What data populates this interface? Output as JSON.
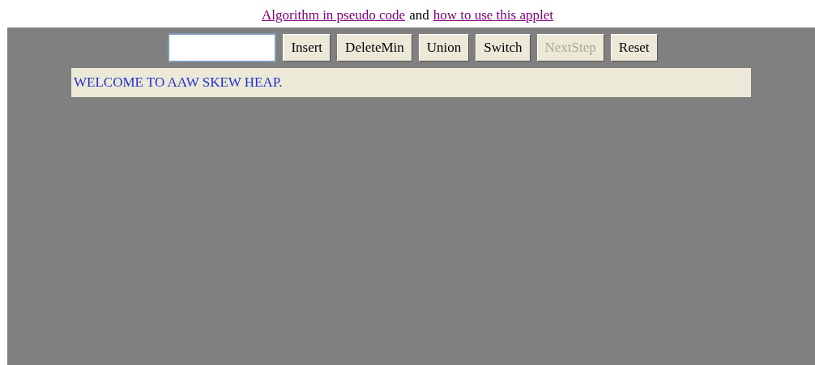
{
  "header": {
    "parts": [
      {
        "kind": "link",
        "text": "Algorithm in pseudo code"
      },
      {
        "kind": "plain",
        "text": "and"
      },
      {
        "kind": "link",
        "text": "how to use this applet"
      }
    ]
  },
  "toolbar": {
    "buttons": [
      {
        "label": "Insert",
        "disabled": false
      },
      {
        "label": "DeleteMin",
        "disabled": false
      },
      {
        "label": "Union",
        "disabled": false
      },
      {
        "label": "Switch",
        "disabled": false
      },
      {
        "label": "NextStep",
        "disabled": true
      },
      {
        "label": "Reset",
        "disabled": false
      }
    ]
  },
  "message": "WELCOME TO AAW SKEW HEAP."
}
